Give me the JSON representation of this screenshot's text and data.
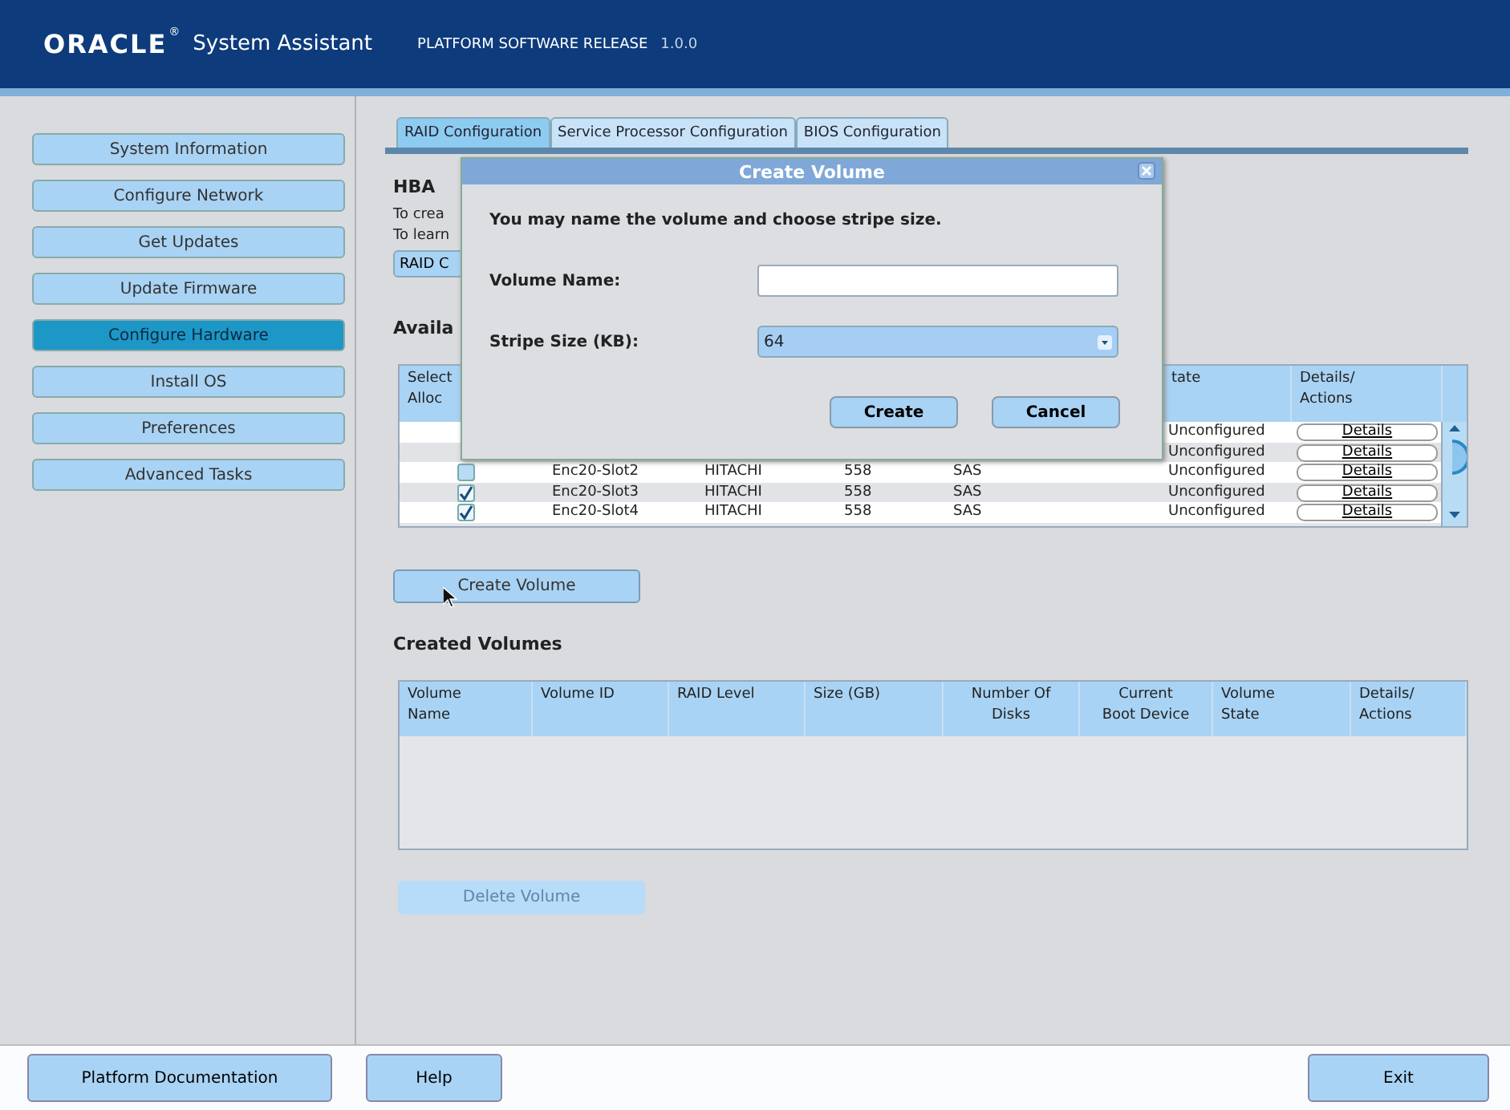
{
  "header": {
    "logo": "ORACLE",
    "logo_mark": "®",
    "title": "System Assistant",
    "release_label": "PLATFORM SOFTWARE RELEASE",
    "version": "1.0.0"
  },
  "sidebar": {
    "items": [
      {
        "label": "System Information",
        "selected": false
      },
      {
        "label": "Configure Network",
        "selected": false
      },
      {
        "label": "Get Updates",
        "selected": false
      },
      {
        "label": "Update Firmware",
        "selected": false
      },
      {
        "label": "Configure Hardware",
        "selected": true
      },
      {
        "label": "Install OS",
        "selected": false
      },
      {
        "label": "Preferences",
        "selected": false
      },
      {
        "label": "Advanced Tasks",
        "selected": false
      }
    ]
  },
  "tabs": [
    {
      "label": "RAID Configuration",
      "selected": true
    },
    {
      "label": "Service Processor Configuration",
      "selected": false
    },
    {
      "label": "BIOS Configuration",
      "selected": false
    }
  ],
  "main": {
    "hba_heading": "HBA",
    "lines": [
      "To crea",
      "To learn"
    ],
    "raid_button": "RAID C",
    "available_heading": "Availa",
    "disk_table": {
      "columns": [
        {
          "lines": [
            "Select",
            "Alloc"
          ]
        },
        {},
        {},
        {},
        {},
        {
          "lines": [
            "tate"
          ]
        },
        {
          "lines": [
            "Details/",
            "Actions"
          ]
        }
      ],
      "rows": [
        {
          "state": "Unconfigured",
          "action": "Details"
        },
        {
          "state": "Unconfigured",
          "action": "Details"
        },
        {
          "checked": false,
          "name": "Enc20-Slot2",
          "vendor": "HITACHI",
          "size": "558",
          "type": "SAS",
          "state": "Unconfigured",
          "action": "Details"
        },
        {
          "checked": true,
          "name": "Enc20-Slot3",
          "vendor": "HITACHI",
          "size": "558",
          "type": "SAS",
          "state": "Unconfigured",
          "action": "Details"
        },
        {
          "checked": true,
          "name": "Enc20-Slot4",
          "vendor": "HITACHI",
          "size": "558",
          "type": "SAS",
          "state": "Unconfigured",
          "action": "Details"
        }
      ]
    },
    "create_button": "Create Volume",
    "created_heading": "Created Volumes",
    "created_table": {
      "columns": [
        [
          "Volume",
          "Name"
        ],
        [
          "Volume ID"
        ],
        [
          "RAID Level"
        ],
        [
          "Size (GB)"
        ],
        [
          "Number Of",
          "Disks"
        ],
        [
          "Current",
          "Boot Device"
        ],
        [
          "Volume",
          "State"
        ],
        [
          "Details/",
          "Actions"
        ]
      ]
    },
    "delete_button": {
      "label": "Delete Volume",
      "disabled": true
    }
  },
  "dialog": {
    "title": "Create Volume",
    "message": "You may name the volume and choose stripe size.",
    "name_label": "Volume Name:",
    "stripe_label": "Stripe Size (KB):",
    "stripe_value": "64",
    "buttons": [
      "Create",
      "Cancel"
    ]
  },
  "footer": {
    "left_buttons": [
      "Platform Documentation",
      "Help"
    ],
    "right_button": "Exit"
  }
}
